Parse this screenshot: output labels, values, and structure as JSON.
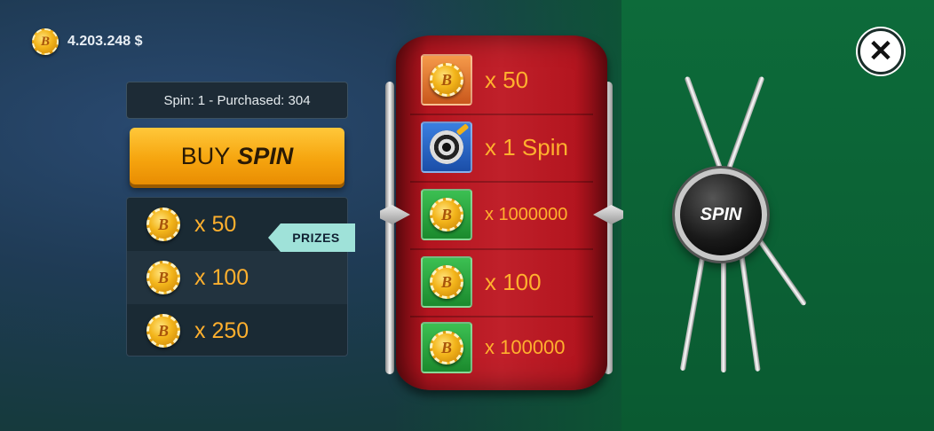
{
  "balance": {
    "amount": "4.203.248 $",
    "coin_letter": "B"
  },
  "spin_info": "Spin: 1 - Purchased: 304",
  "buy_button": {
    "prefix": "BUY",
    "emphasis": "SPIN"
  },
  "prizes_tag": "PRIZES",
  "prize_list": [
    {
      "label": "x 50",
      "icon": "coin-icon"
    },
    {
      "label": "x 100",
      "icon": "coin-icon"
    },
    {
      "label": "x 250",
      "icon": "coin-icon"
    }
  ],
  "wheel": [
    {
      "label": "x 50",
      "tile": "orange",
      "icon": "coin-icon"
    },
    {
      "label": "x 1 Spin",
      "tile": "blue",
      "icon": "target-icon"
    },
    {
      "label": "x 1000000",
      "tile": "green",
      "icon": "coin-icon"
    },
    {
      "label": "x 100",
      "tile": "green",
      "icon": "coin-icon"
    },
    {
      "label": "x 100000",
      "tile": "green",
      "icon": "coin-icon"
    }
  ],
  "spin_button": "SPIN",
  "close_icon": "close-icon",
  "colors": {
    "accent": "#f6a50f",
    "prize_text": "#ffb02e",
    "wheel": "#c0202a",
    "panel_green": "#0d6b3a"
  }
}
